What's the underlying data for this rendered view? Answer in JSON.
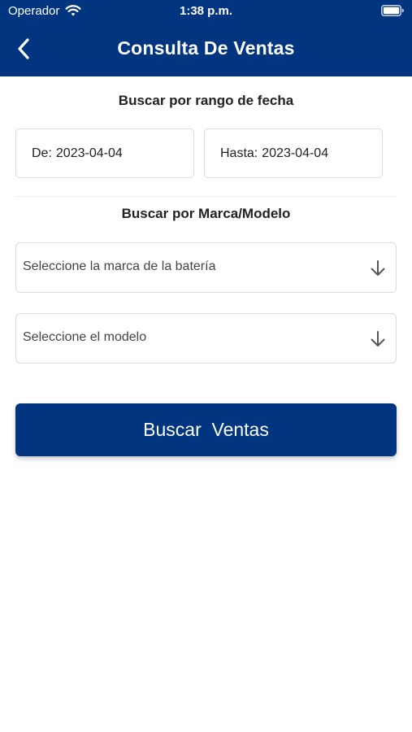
{
  "status_bar": {
    "carrier": "Operador",
    "time": "1:38 p.m.",
    "wifi_icon": "wifi-icon",
    "battery_icon": "battery-icon"
  },
  "nav": {
    "title": "Consulta De Ventas",
    "back_icon": "chevron-left-icon"
  },
  "date_section": {
    "title": "Buscar por rango de fecha",
    "from_label": "De:",
    "from_value": "2023-04-04",
    "to_label": "Hasta:",
    "to_value": "2023-04-04"
  },
  "brand_section": {
    "title": "Buscar por Marca/Modelo",
    "brand_placeholder": "Seleccione la marca de la batería",
    "model_placeholder": "Seleccione el modelo",
    "dropdown_icon": "arrow-down-icon"
  },
  "search_button": {
    "label": "Buscar  Ventas"
  },
  "colors": {
    "primary": "#013580",
    "background": "#ffffff",
    "border": "#dcdcdc"
  }
}
